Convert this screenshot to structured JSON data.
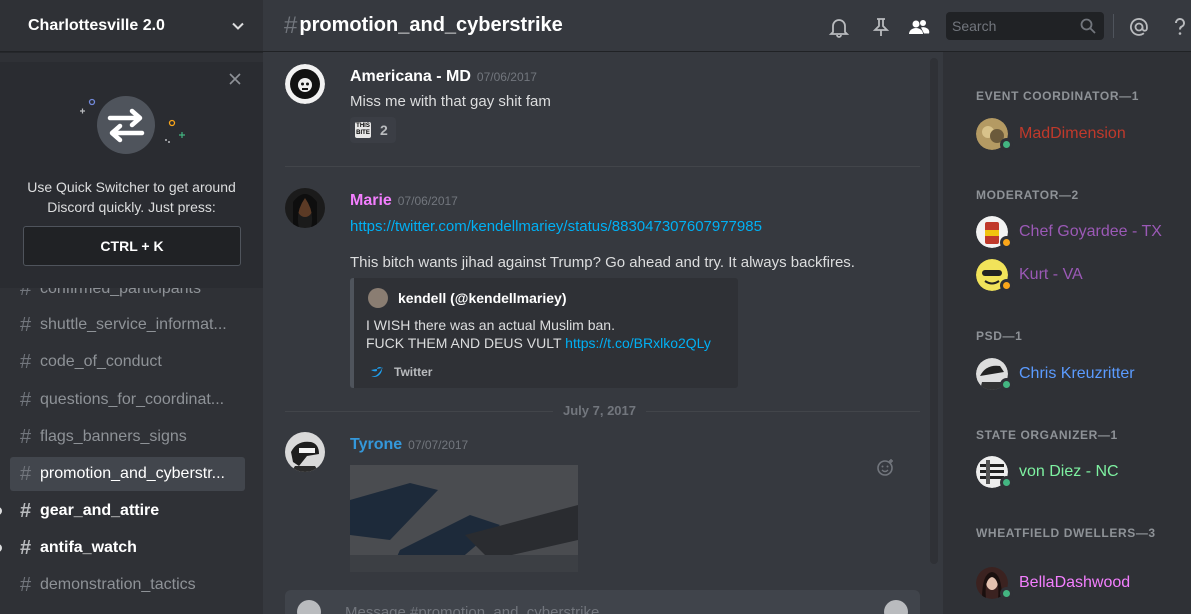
{
  "server": {
    "name": "Charlottesville 2.0"
  },
  "quick_switcher": {
    "line1": "Use Quick Switcher to get around",
    "line2": "Discord quickly. Just press:",
    "shortcut": "CTRL + K"
  },
  "channels": [
    {
      "name": "confirmed_participants",
      "state": "normal"
    },
    {
      "name": "shuttle_service_informat...",
      "state": "normal"
    },
    {
      "name": "code_of_conduct",
      "state": "normal"
    },
    {
      "name": "questions_for_coordinat...",
      "state": "normal"
    },
    {
      "name": "flags_banners_signs",
      "state": "normal"
    },
    {
      "name": "promotion_and_cyberstr...",
      "state": "active"
    },
    {
      "name": "gear_and_attire",
      "state": "unread"
    },
    {
      "name": "antifa_watch",
      "state": "unread"
    },
    {
      "name": "demonstration_tactics",
      "state": "normal"
    }
  ],
  "header": {
    "channel": "promotion_and_cyberstrike",
    "search_placeholder": "Search"
  },
  "messages": [
    {
      "author": "Americana - MD",
      "author_color": "#ffffff",
      "timestamp": "07/06/2017",
      "lines": [
        "Miss me with that gay shit fam"
      ],
      "reaction": {
        "emoji": "THIS BITE",
        "count": "2"
      }
    },
    {
      "author": "Marie",
      "author_color": "#f47fff",
      "timestamp": "07/06/2017",
      "link": "https://twitter.com/kendellmariey/status/883047307607977985",
      "lines": [
        "This bitch wants jihad against Trump? Go ahead and try. It always backfires."
      ],
      "embed": {
        "author": "kendell (@kendellmariey)",
        "line1": "I WISH there was an actual Muslim ban.",
        "line2_text": "FUCK THEM AND DEUS VULT ",
        "line2_link": "https://t.co/BRxlko2QLy",
        "footer": "Twitter"
      }
    },
    {
      "date_divider": "July 7, 2017",
      "author": "Tyrone",
      "author_color": "#3498db",
      "timestamp": "07/07/2017"
    }
  ],
  "composer": {
    "placeholder": "Message #promotion_and_cyberstrike"
  },
  "members": {
    "roles": [
      {
        "label": "EVENT COORDINATOR—1"
      },
      {
        "label": "MODERATOR—2"
      },
      {
        "label": "PSD—1"
      },
      {
        "label": "STATE ORGANIZER—1"
      },
      {
        "label": "WHEATFIELD DWELLERS—3"
      }
    ],
    "list": [
      {
        "name": "MadDimension",
        "color": "#c0392b",
        "status": "online"
      },
      {
        "name": "Chef Goyardee - TX",
        "color": "#9b59b6",
        "status": "idle"
      },
      {
        "name": "Kurt - VA",
        "color": "#9b59b6",
        "status": "idle"
      },
      {
        "name": "Chris Kreuzritter",
        "color": "#5b9bff",
        "status": "online"
      },
      {
        "name": "von Diez - NC",
        "color": "#7ef1a1",
        "status": "online"
      },
      {
        "name": "BellaDashwood",
        "color": "#f47fff",
        "status": "online"
      }
    ]
  }
}
